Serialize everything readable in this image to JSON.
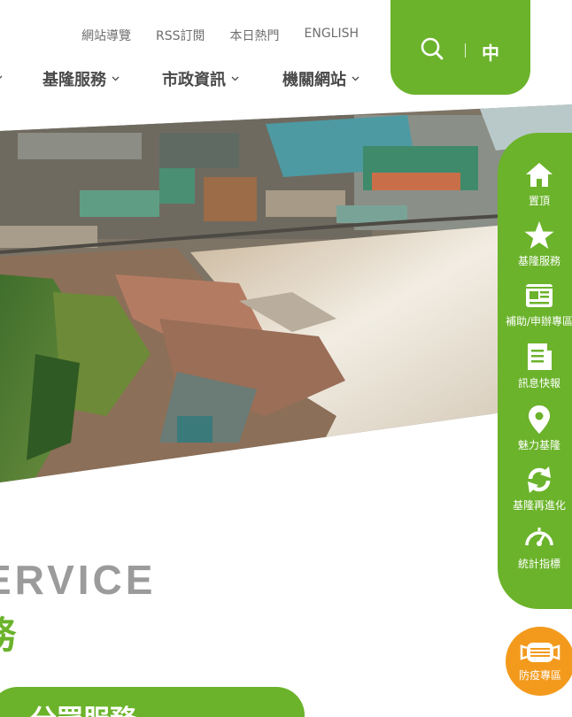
{
  "top_links": [
    "網站導覽",
    "RSS訂閱",
    "本日熱門",
    "ENGLISH"
  ],
  "main_nav": [
    {
      "label": "基隆服務"
    },
    {
      "label": "市政資訊"
    },
    {
      "label": "機關網站"
    }
  ],
  "language": "中",
  "section": {
    "title_en": "ERVICE",
    "title_zh": "務",
    "category_label": "分眾服務"
  },
  "side_menu": [
    {
      "label": "置頂",
      "icon": "home-icon"
    },
    {
      "label": "基隆服務",
      "icon": "star-icon"
    },
    {
      "label": "補助/申辦專區",
      "icon": "id-card-icon"
    },
    {
      "label": "訊息快報",
      "icon": "document-icon"
    },
    {
      "label": "魅力基隆",
      "icon": "location-pin-icon"
    },
    {
      "label": "基隆再進化",
      "icon": "refresh-icon"
    },
    {
      "label": "統計指標",
      "icon": "gauge-icon"
    }
  ],
  "epidemic_button": {
    "label": "防疫專區",
    "icon": "mask-icon"
  },
  "colors": {
    "brand_green": "#6bb32b",
    "accent_orange": "#f39a1d",
    "nav_text": "#4a4a4a"
  }
}
